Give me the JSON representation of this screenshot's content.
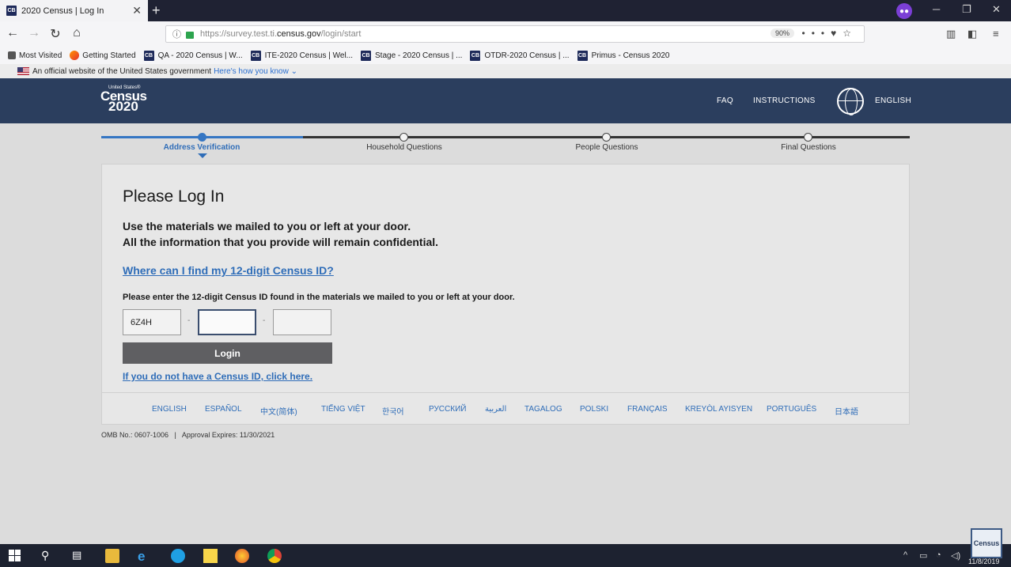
{
  "browser": {
    "tab_title": "2020 Census | Log In",
    "tab_close": "✕",
    "new_tab": "+",
    "url_prefix": "https://survey.test.ti.",
    "url_domain": "census.gov",
    "url_path": "/login/start",
    "zoom": "90%",
    "bookmarks": [
      {
        "label": "Most Visited",
        "icon": "gear-icon"
      },
      {
        "label": "Getting Started",
        "icon": "firefox-icon"
      },
      {
        "label": "QA - 2020 Census | W...",
        "icon": "cb-favicon"
      },
      {
        "label": "ITE-2020 Census | Wel...",
        "icon": "cb-favicon"
      },
      {
        "label": "Stage - 2020 Census | ...",
        "icon": "cb-favicon"
      },
      {
        "label": "OTDR-2020 Census | ...",
        "icon": "cb-favicon"
      },
      {
        "label": "Primus - Census 2020",
        "icon": "cb-favicon"
      }
    ],
    "favicon_text": "CB"
  },
  "gov_banner": {
    "text": "An official website of the United States government",
    "link": "Here's how you know"
  },
  "header": {
    "logo_us": "United States®",
    "logo_word": "Census",
    "logo_year": "2020",
    "faq": "FAQ",
    "instructions": "INSTRUCTIONS",
    "language": "ENGLISH"
  },
  "progress": {
    "steps": [
      "Address Verification",
      "Household Questions",
      "People Questions",
      "Final Questions"
    ],
    "current": 0
  },
  "login": {
    "title": "Please Log In",
    "intro_line1": "Use the materials we mailed to you or left at your door.",
    "intro_line2": "All the information that you provide will remain confidential.",
    "where_link": "Where can I find my 12-digit Census ID?",
    "instruction": "Please enter the 12-digit Census ID found in the materials we mailed to you or left at your door.",
    "id_part1": "6Z4H",
    "id_part2": "",
    "id_part3": "",
    "separator": "-",
    "login_button": "Login",
    "no_id_link": "If you do not have a Census ID, click here."
  },
  "languages": [
    "ENGLISH",
    "ESPAÑOL",
    "中文(简体)",
    "TIẾNG VIỆT",
    "한국어",
    "РУССКИЙ",
    "العربية",
    "TAGALOG",
    "POLSKI",
    "FRANÇAIS",
    "KREYÒL AYISYEN",
    "PORTUGUÊS",
    "日本語"
  ],
  "footer": {
    "omb": "OMB No.: 0607-1006   |   Approval Expires: 11/30/2021"
  },
  "taskbar": {
    "date": "11/8/2019",
    "thumb_label": "Census"
  },
  "colors": {
    "header_bg": "#2b3e5e",
    "accent": "#2f6db8",
    "button": "#5f5f62"
  }
}
